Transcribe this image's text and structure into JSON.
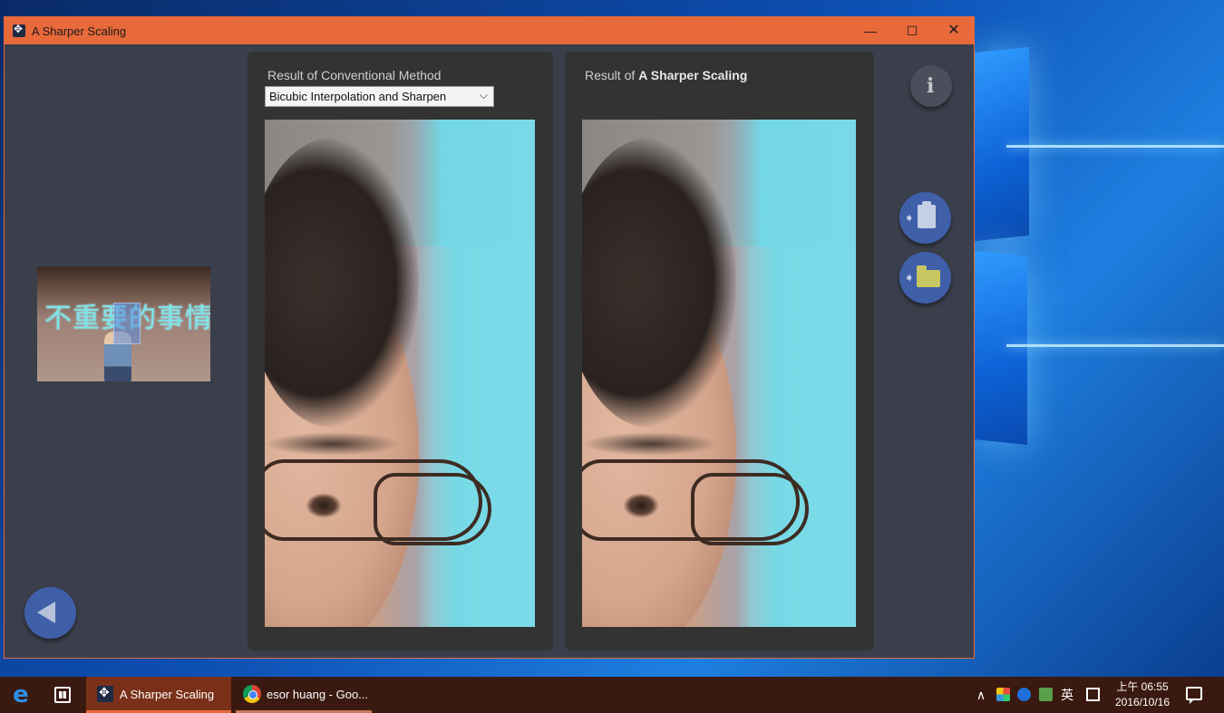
{
  "window": {
    "title": "A Sharper Scaling",
    "controls": {
      "minimize": "—",
      "maximize": "☐",
      "close": "✕"
    }
  },
  "thumbnail": {
    "caption_text": "不重要的事情"
  },
  "left_panel": {
    "label": "Result of Conventional Method",
    "method_select": {
      "selected": "Bicubic Interpolation and Sharpen"
    }
  },
  "right_panel": {
    "label_prefix": "Result of",
    "label_emphasis": "A Sharper Scaling"
  },
  "side_buttons": {
    "info_glyph": "i",
    "icons": [
      "info-icon",
      "copy-to-clipboard-icon",
      "save-to-folder-icon",
      "back-arrow-icon"
    ]
  },
  "taskbar": {
    "items": [
      {
        "label": "A Sharper Scaling"
      },
      {
        "label": "esor huang - Goo..."
      }
    ],
    "ime": "英",
    "clock_time": "上午 06:55",
    "clock_date": "2016/10/16",
    "tray_chevron": "∧"
  },
  "colors": {
    "titlebar": "#e8693a",
    "window_bg": "#3a3f4b",
    "panel_bg": "#333333",
    "round_button": "#3f5fa8",
    "folder_icon": "#c8c660"
  }
}
